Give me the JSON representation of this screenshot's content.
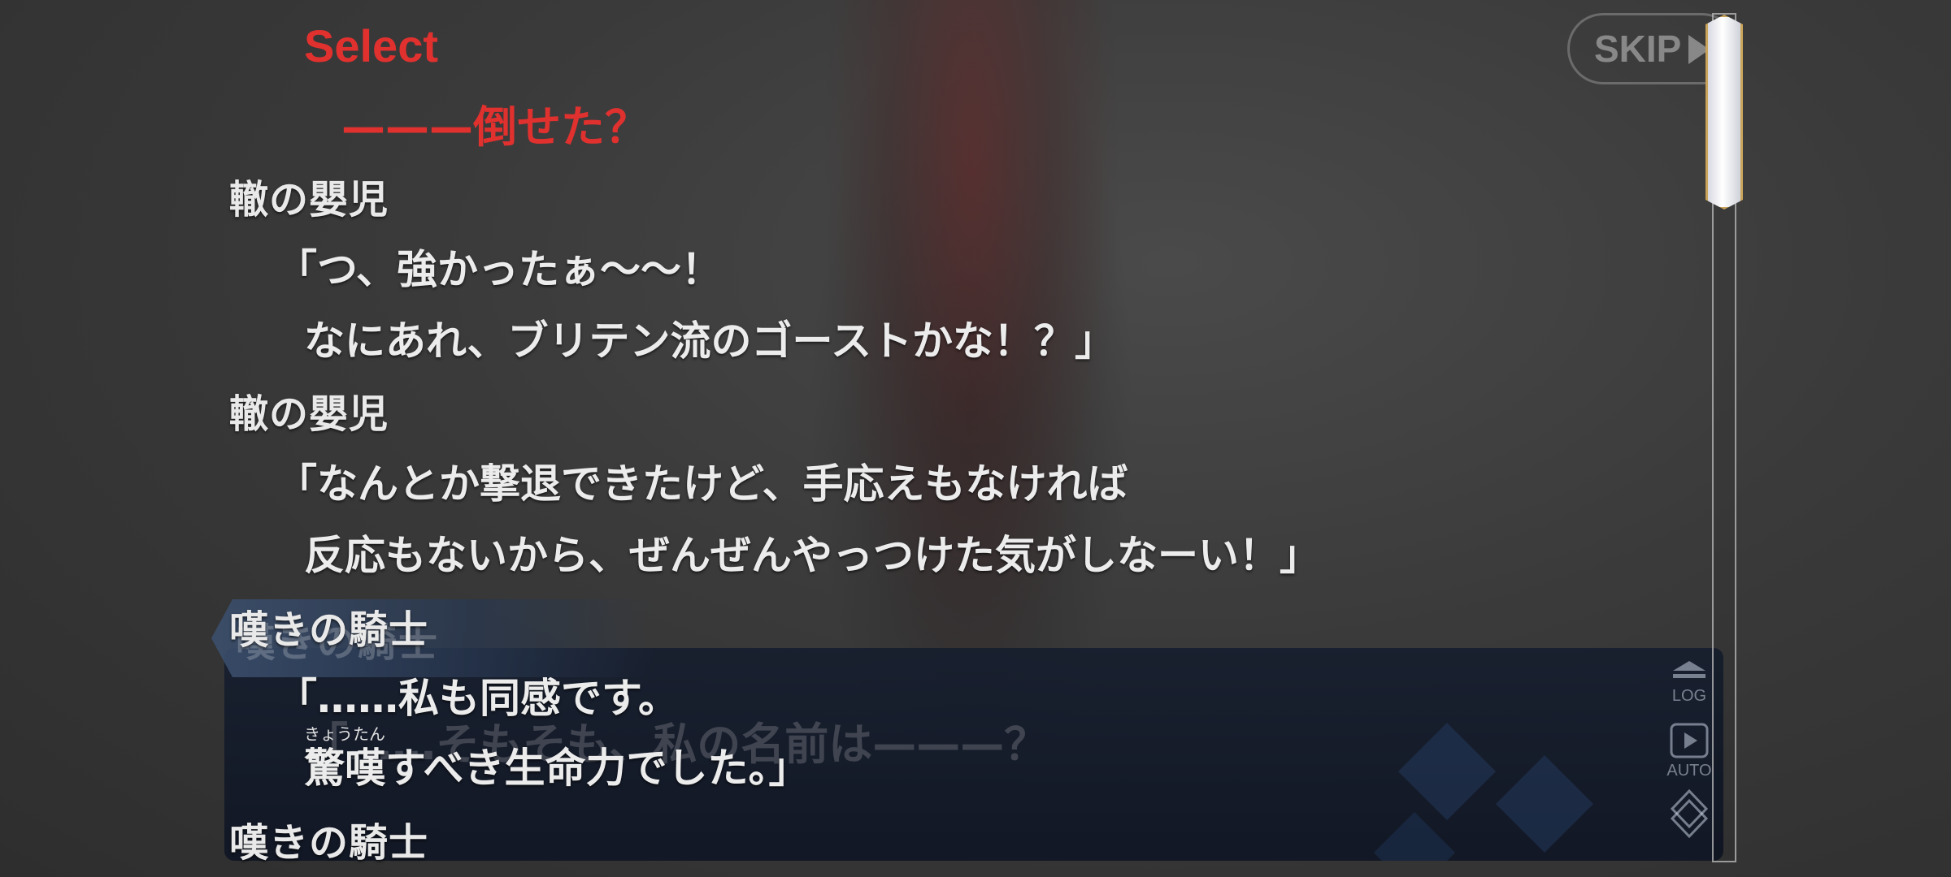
{
  "select": {
    "title": "Select",
    "choice": "———倒せた？"
  },
  "log": [
    {
      "speaker": "轍の嬰児",
      "lines": [
        "「つ、強かったぁ〜〜！",
        "なにあれ、ブリテン流のゴーストかな！？」"
      ]
    },
    {
      "speaker": "轍の嬰児",
      "lines": [
        "「なんとか撃退できたけど、手応えもなければ",
        "反応もないから、ぜんぜんやっつけた気がしなーい！」"
      ]
    },
    {
      "speaker": "嘆きの騎士",
      "lines": [
        "「……私も同感です。",
        "驚嘆すべき生命力でした。」"
      ],
      "ruby": "きょうたん"
    },
    {
      "speaker": "嘆きの騎士",
      "lines": []
    }
  ],
  "message_window": {
    "speaker": "嘆きの騎士",
    "text": "「……そもそも、私の名前は———？"
  },
  "controls": {
    "skip_label": "SKIP",
    "log_label": "LOG",
    "auto_label": "AUTO"
  },
  "colors": {
    "select_red": "#e0312f",
    "scroll_gold": "#c9a45a"
  },
  "icons": {
    "skip": "play-triangle-icon",
    "log": "log-icon",
    "auto": "play-icon",
    "menu": "diamond-icon"
  }
}
